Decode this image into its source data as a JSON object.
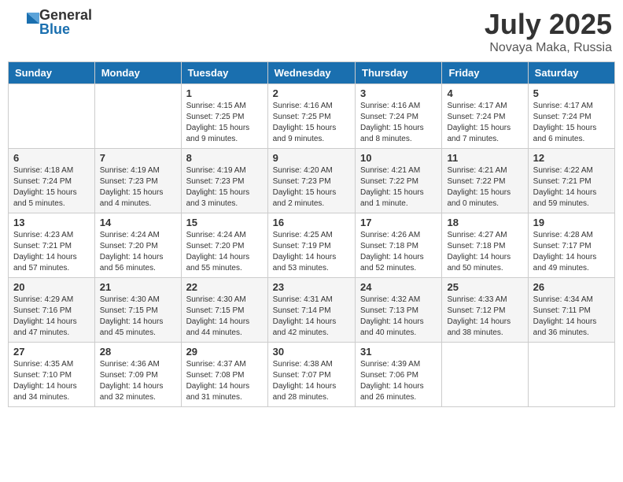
{
  "header": {
    "logo_general": "General",
    "logo_blue": "Blue",
    "month_year": "July 2025",
    "location": "Novaya Maka, Russia"
  },
  "weekdays": [
    "Sunday",
    "Monday",
    "Tuesday",
    "Wednesday",
    "Thursday",
    "Friday",
    "Saturday"
  ],
  "weeks": [
    [
      {
        "day": "",
        "info": ""
      },
      {
        "day": "",
        "info": ""
      },
      {
        "day": "1",
        "info": "Sunrise: 4:15 AM\nSunset: 7:25 PM\nDaylight: 15 hours and 9 minutes."
      },
      {
        "day": "2",
        "info": "Sunrise: 4:16 AM\nSunset: 7:25 PM\nDaylight: 15 hours and 9 minutes."
      },
      {
        "day": "3",
        "info": "Sunrise: 4:16 AM\nSunset: 7:24 PM\nDaylight: 15 hours and 8 minutes."
      },
      {
        "day": "4",
        "info": "Sunrise: 4:17 AM\nSunset: 7:24 PM\nDaylight: 15 hours and 7 minutes."
      },
      {
        "day": "5",
        "info": "Sunrise: 4:17 AM\nSunset: 7:24 PM\nDaylight: 15 hours and 6 minutes."
      }
    ],
    [
      {
        "day": "6",
        "info": "Sunrise: 4:18 AM\nSunset: 7:24 PM\nDaylight: 15 hours and 5 minutes."
      },
      {
        "day": "7",
        "info": "Sunrise: 4:19 AM\nSunset: 7:23 PM\nDaylight: 15 hours and 4 minutes."
      },
      {
        "day": "8",
        "info": "Sunrise: 4:19 AM\nSunset: 7:23 PM\nDaylight: 15 hours and 3 minutes."
      },
      {
        "day": "9",
        "info": "Sunrise: 4:20 AM\nSunset: 7:23 PM\nDaylight: 15 hours and 2 minutes."
      },
      {
        "day": "10",
        "info": "Sunrise: 4:21 AM\nSunset: 7:22 PM\nDaylight: 15 hours and 1 minute."
      },
      {
        "day": "11",
        "info": "Sunrise: 4:21 AM\nSunset: 7:22 PM\nDaylight: 15 hours and 0 minutes."
      },
      {
        "day": "12",
        "info": "Sunrise: 4:22 AM\nSunset: 7:21 PM\nDaylight: 14 hours and 59 minutes."
      }
    ],
    [
      {
        "day": "13",
        "info": "Sunrise: 4:23 AM\nSunset: 7:21 PM\nDaylight: 14 hours and 57 minutes."
      },
      {
        "day": "14",
        "info": "Sunrise: 4:24 AM\nSunset: 7:20 PM\nDaylight: 14 hours and 56 minutes."
      },
      {
        "day": "15",
        "info": "Sunrise: 4:24 AM\nSunset: 7:20 PM\nDaylight: 14 hours and 55 minutes."
      },
      {
        "day": "16",
        "info": "Sunrise: 4:25 AM\nSunset: 7:19 PM\nDaylight: 14 hours and 53 minutes."
      },
      {
        "day": "17",
        "info": "Sunrise: 4:26 AM\nSunset: 7:18 PM\nDaylight: 14 hours and 52 minutes."
      },
      {
        "day": "18",
        "info": "Sunrise: 4:27 AM\nSunset: 7:18 PM\nDaylight: 14 hours and 50 minutes."
      },
      {
        "day": "19",
        "info": "Sunrise: 4:28 AM\nSunset: 7:17 PM\nDaylight: 14 hours and 49 minutes."
      }
    ],
    [
      {
        "day": "20",
        "info": "Sunrise: 4:29 AM\nSunset: 7:16 PM\nDaylight: 14 hours and 47 minutes."
      },
      {
        "day": "21",
        "info": "Sunrise: 4:30 AM\nSunset: 7:15 PM\nDaylight: 14 hours and 45 minutes."
      },
      {
        "day": "22",
        "info": "Sunrise: 4:30 AM\nSunset: 7:15 PM\nDaylight: 14 hours and 44 minutes."
      },
      {
        "day": "23",
        "info": "Sunrise: 4:31 AM\nSunset: 7:14 PM\nDaylight: 14 hours and 42 minutes."
      },
      {
        "day": "24",
        "info": "Sunrise: 4:32 AM\nSunset: 7:13 PM\nDaylight: 14 hours and 40 minutes."
      },
      {
        "day": "25",
        "info": "Sunrise: 4:33 AM\nSunset: 7:12 PM\nDaylight: 14 hours and 38 minutes."
      },
      {
        "day": "26",
        "info": "Sunrise: 4:34 AM\nSunset: 7:11 PM\nDaylight: 14 hours and 36 minutes."
      }
    ],
    [
      {
        "day": "27",
        "info": "Sunrise: 4:35 AM\nSunset: 7:10 PM\nDaylight: 14 hours and 34 minutes."
      },
      {
        "day": "28",
        "info": "Sunrise: 4:36 AM\nSunset: 7:09 PM\nDaylight: 14 hours and 32 minutes."
      },
      {
        "day": "29",
        "info": "Sunrise: 4:37 AM\nSunset: 7:08 PM\nDaylight: 14 hours and 31 minutes."
      },
      {
        "day": "30",
        "info": "Sunrise: 4:38 AM\nSunset: 7:07 PM\nDaylight: 14 hours and 28 minutes."
      },
      {
        "day": "31",
        "info": "Sunrise: 4:39 AM\nSunset: 7:06 PM\nDaylight: 14 hours and 26 minutes."
      },
      {
        "day": "",
        "info": ""
      },
      {
        "day": "",
        "info": ""
      }
    ]
  ]
}
